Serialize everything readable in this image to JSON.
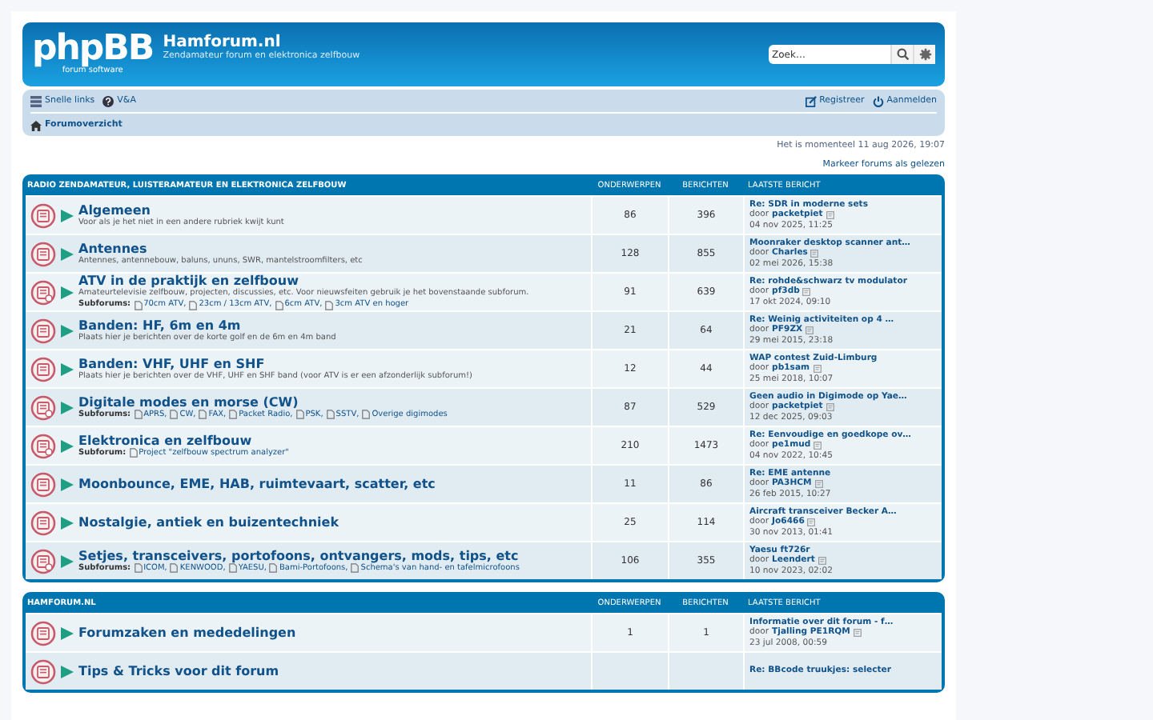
{
  "header": {
    "logo": {
      "name": "phpBB",
      "tagline": "forum software"
    },
    "site_title": "Hamforum.nl",
    "site_description": "Zendamateur forum en elektronica zelfbouw",
    "search": {
      "placeholder": "Zoek…"
    }
  },
  "nav": {
    "quick_links": "Snelle links",
    "faq": "V&A",
    "register": "Registreer",
    "login": "Aanmelden",
    "breadcrumb": "Forumoverzicht"
  },
  "current_time": "Het is momenteel 11 aug 2026, 19:07",
  "mark_read": "Markeer forums als gelezen",
  "categories": [
    {
      "title": "RADIO ZENDAMATEUR, LUISTERAMATEUR EN ELEKTRONICA ZELFBOUW",
      "columns": [
        "ONDERWERPEN",
        "BERICHTEN",
        "LAATSTE BERICHT"
      ],
      "forums": [
        {
          "title": "Algemeen",
          "description": "Voor als je het niet in een andere rubriek kwijt kunt",
          "topics": "86",
          "posts": "396",
          "last_post": {
            "title": "Re: SDR in moderne sets",
            "by": "door",
            "author": "packetpiet",
            "date": "04 nov 2025, 11:25"
          }
        },
        {
          "title": "Antennes",
          "description": "Antennes, antennebouw, baluns, ununs, SWR, mantelstroomfilters, etc",
          "topics": "128",
          "posts": "855",
          "last_post": {
            "title": "Moonraker desktop scanner ant…",
            "by": "door",
            "author": "Charles",
            "date": "02 mei 2026, 15:38"
          }
        },
        {
          "title": "ATV in de praktijk en zelfbouw",
          "description": "Amateurtelevisie zelfbouw, projecten, discussies, etc. Voor nieuwsfeiten gebruik je het bovenstaande subforum.",
          "subforums_label": "Subforums:",
          "subforums": [
            "70cm ATV,",
            "23cm / 13cm ATV,",
            "6cm ATV,",
            "3cm ATV en hoger"
          ],
          "topics": "91",
          "posts": "639",
          "last_post": {
            "title": "Re: rohde&schwarz tv modulator",
            "by": "door",
            "author": "pf3db",
            "date": "17 okt 2024, 09:10"
          }
        },
        {
          "title": "Banden: HF, 6m en 4m",
          "description": "Plaats hier je berichten over de korte golf en de 6m en 4m band",
          "topics": "21",
          "posts": "64",
          "last_post": {
            "title": "Re: Weinig activiteiten op 4 …",
            "by": "door",
            "author": "PF9ZX",
            "date": "29 mei 2015, 23:18"
          }
        },
        {
          "title": "Banden: VHF, UHF en SHF",
          "description": "Plaats hier je berichten over de VHF, UHF en SHF band (voor ATV is er een afzonderlijk subforum!)",
          "topics": "12",
          "posts": "44",
          "last_post": {
            "title": "WAP contest Zuid-Limburg",
            "by": "door",
            "author": "pb1sam",
            "date": "25 mei 2018, 10:07"
          }
        },
        {
          "title": "Digitale modes en morse (CW)",
          "subforums_label": "Subforums:",
          "subforums": [
            "APRS,",
            "CW,",
            "FAX,",
            "Packet Radio,",
            "PSK,",
            "SSTV,",
            "Overige digimodes"
          ],
          "topics": "87",
          "posts": "529",
          "last_post": {
            "title": "Geen audio in Digimode op Yae…",
            "by": "door",
            "author": "packetpiet",
            "date": "12 dec 2025, 09:03"
          }
        },
        {
          "title": "Elektronica en zelfbouw",
          "subforums_label": "Subforum:",
          "subforums": [
            "Project \"zelfbouw spectrum analyzer\""
          ],
          "topics": "210",
          "posts": "1473",
          "last_post": {
            "title": "Re: Eenvoudige en goedkope ov…",
            "by": "door",
            "author": "pe1mud",
            "date": "04 nov 2022, 10:45"
          }
        },
        {
          "title": "Moonbounce, EME, HAB, ruimtevaart, scatter, etc",
          "topics": "11",
          "posts": "86",
          "last_post": {
            "title": "Re: EME antenne",
            "by": "door",
            "author": "PA3HCM",
            "date": "26 feb 2015, 10:27"
          }
        },
        {
          "title": "Nostalgie, antiek en buizentechniek",
          "topics": "25",
          "posts": "114",
          "last_post": {
            "title": "Aircraft transceiver Becker A…",
            "by": "door",
            "author": "Jo6466",
            "date": "30 nov 2013, 01:41"
          }
        },
        {
          "title": "Setjes, transceivers, portofoons, ontvangers, mods, tips, etc",
          "subforums_label": "Subforums:",
          "subforums": [
            "ICOM,",
            "KENWOOD,",
            "YAESU,",
            "Bami-Portofoons,",
            "Schema's van hand- en tafelmicrofoons"
          ],
          "topics": "106",
          "posts": "355",
          "last_post": {
            "title": "Yaesu ft726r",
            "by": "door",
            "author": "Leendert",
            "date": "10 nov 2023, 02:02"
          }
        }
      ]
    },
    {
      "title": "HAMFORUM.NL",
      "columns": [
        "ONDERWERPEN",
        "BERICHTEN",
        "LAATSTE BERICHT"
      ],
      "forums": [
        {
          "title": "Forumzaken en mededelingen",
          "topics": "1",
          "posts": "1",
          "last_post": {
            "title": "Informatie over dit forum - f…",
            "by": "door",
            "author": "Tjalling PE1RQM",
            "date": "23 jul 2008, 00:59"
          }
        },
        {
          "title": "Tips & Tricks voor dit forum",
          "last_post": {
            "title": "Re: BBcode truukjes: selecter"
          }
        }
      ]
    }
  ]
}
